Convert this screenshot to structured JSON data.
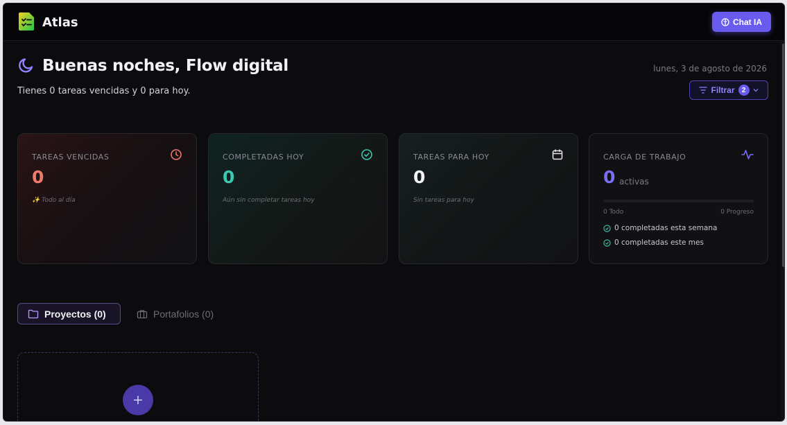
{
  "app": {
    "title": "Atlas",
    "chat_button": "Chat IA"
  },
  "header": {
    "greeting": "Buenas noches, Flow digital",
    "subtitle": "Tienes 0 tareas vencidas y 0 para hoy.",
    "date": "lunes, 3 de agosto de 2026",
    "filter_label": "Filtrar",
    "filter_count": "2"
  },
  "cards": {
    "overdue": {
      "label": "TAREAS VENCIDAS",
      "value": "0",
      "note": "✨ Todo al día",
      "color": "#f07a6a",
      "icon": "clock-icon"
    },
    "completed": {
      "label": "COMPLETADAS HOY",
      "value": "0",
      "note": "Aún sin completar tareas hoy",
      "color": "#3ec6b0",
      "icon": "check-circle-icon"
    },
    "today": {
      "label": "TAREAS PARA HOY",
      "value": "0",
      "note": "Sin tareas para hoy",
      "color": "#f2f2f5",
      "icon": "calendar-icon"
    },
    "workload": {
      "label": "CARGA DE TRABAJO",
      "value": "0",
      "unit": "activas",
      "color": "#7b6cf6",
      "icon": "activity-icon",
      "progress": 0,
      "todo": "0 Todo",
      "in_progress": "0 Progreso",
      "week": "0 completadas esta semana",
      "month": "0 completadas este mes"
    }
  },
  "tabs": [
    {
      "label": "Proyectos (0)",
      "icon": "folder-icon",
      "active": true
    },
    {
      "label": "Portafolios (0)",
      "icon": "briefcase-icon",
      "active": false
    }
  ]
}
